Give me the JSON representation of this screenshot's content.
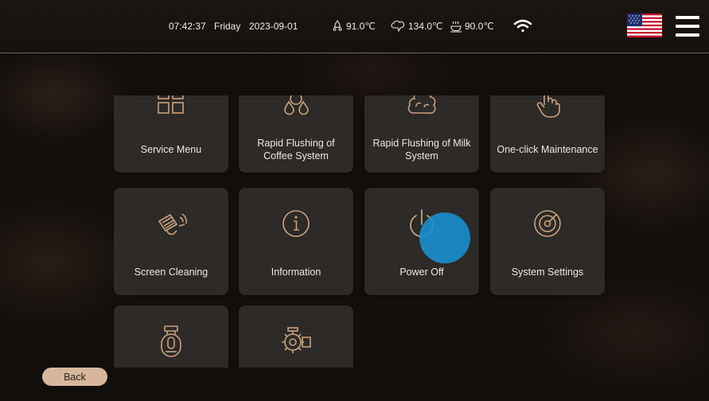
{
  "status_bar": {
    "time": "07:42:37",
    "day": "Friday",
    "date": "2023-09-01",
    "temp_coffee": "91.0℃",
    "temp_steam": "134.0℃",
    "temp_cup": "90.0℃",
    "wifi_icon": "wifi-icon",
    "language_flag": "us-flag-icon",
    "menu_icon": "hamburger-menu-icon"
  },
  "tiles": [
    {
      "label": "Service Menu",
      "icon": "grid-icon"
    },
    {
      "label": "Rapid Flushing of Coffee System",
      "icon": "droplets-icon"
    },
    {
      "label": "Rapid Flushing of Milk System",
      "icon": "foam-icon"
    },
    {
      "label": "One-click Maintenance",
      "icon": "touch-hand-icon"
    },
    {
      "label": "Screen Cleaning",
      "icon": "wiping-hand-icon"
    },
    {
      "label": "Information",
      "icon": "info-icon"
    },
    {
      "label": "Power Off",
      "icon": "power-icon"
    },
    {
      "label": "System Settings",
      "icon": "settings-dial-icon"
    },
    {
      "label": "",
      "icon": "brewer-icon"
    },
    {
      "label": "",
      "icon": "grinder-icon"
    }
  ],
  "footer": {
    "back_label": "Back"
  },
  "colors": {
    "accent": "#d6b79d",
    "tile": "#2d2a27",
    "touch_indicator": "#1a8fd0"
  }
}
